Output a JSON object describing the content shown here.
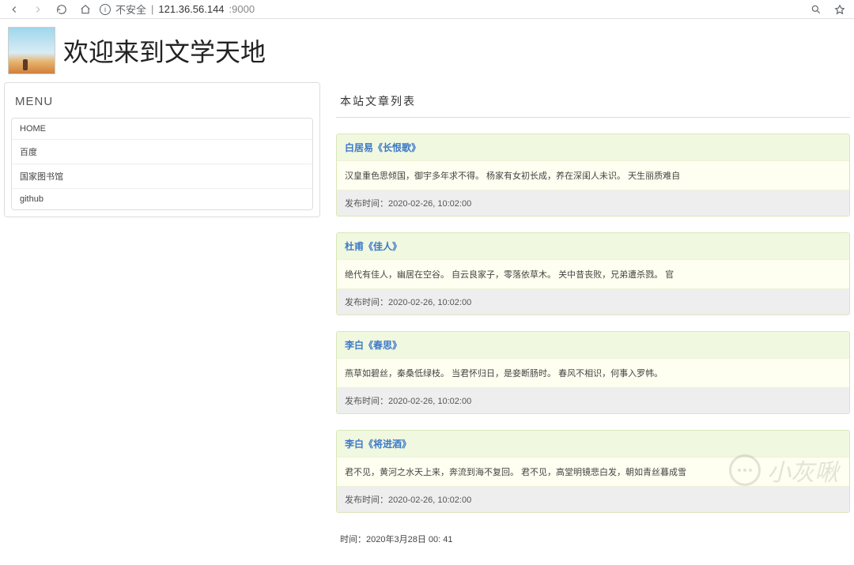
{
  "browser": {
    "insecure_label": "不安全",
    "url_host": "121.36.56.144",
    "url_port": ":9000"
  },
  "header": {
    "title": "欢迎来到文学天地"
  },
  "sidebar": {
    "menu_heading": "MENU",
    "items": [
      {
        "label": "HOME"
      },
      {
        "label": "百度"
      },
      {
        "label": "国家图书馆"
      },
      {
        "label": "github"
      }
    ]
  },
  "main": {
    "list_heading": "本站文章列表",
    "articles": [
      {
        "title": "白居易《长恨歌》",
        "excerpt": "汉皇重色思倾国，御宇多年求不得。 杨家有女初长成，养在深闺人未识。 天生丽质难自",
        "meta": "发布时间：2020-02-26, 10:02:00"
      },
      {
        "title": "杜甫《佳人》",
        "excerpt": "绝代有佳人，幽居在空谷。 自云良家子，零落依草木。 关中昔丧败，兄弟遭杀戮。 官",
        "meta": "发布时间：2020-02-26, 10:02:00"
      },
      {
        "title": "李白《春思》",
        "excerpt": "燕草如碧丝，秦桑低绿枝。 当君怀归日，是妾断肠时。 春风不相识，何事入罗帏。",
        "meta": "发布时间：2020-02-26, 10:02:00"
      },
      {
        "title": "李白《将进酒》",
        "excerpt": "君不见，黄河之水天上来，奔流到海不复回。 君不见，高堂明镜悲白发，朝如青丝暮成雪",
        "meta": "发布时间：2020-02-26, 10:02:00"
      }
    ],
    "footer_time": "时间：2020年3月28日  00: 41"
  },
  "watermark": {
    "text": "小灰啾"
  }
}
